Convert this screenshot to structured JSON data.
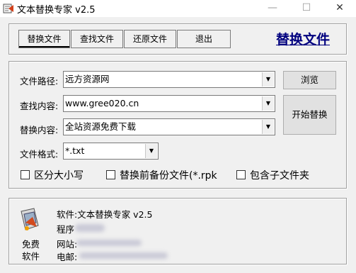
{
  "window": {
    "title": "文本替换专家    v2.5",
    "min_glyph": "—",
    "max_glyph": "☐",
    "close_glyph": "✕"
  },
  "toolbar": {
    "tabs": [
      "替换文件",
      "查找文件",
      "还原文件",
      "退出"
    ],
    "active_tab": "替换文件"
  },
  "page_title": "替换文件",
  "form": {
    "path_label": "文件路径:",
    "path_value": "远方资源网",
    "find_label": "查找内容:",
    "find_value": "www.gree020.cn",
    "replace_label": "替换内容:",
    "replace_value": "全站资源免费下载",
    "format_label": "文件格式:",
    "format_value": "*.txt",
    "browse_button": "浏览",
    "start_button": "开始替换",
    "dropdown_glyph": "▼"
  },
  "options": [
    {
      "label": "区分大小写",
      "checked": false
    },
    {
      "label": "替换前备份文件(*.rpk",
      "checked": false
    },
    {
      "label": "包含子文件夹",
      "checked": false
    }
  ],
  "about": {
    "badge_line1": "免费",
    "badge_line2": "软件",
    "software": "软件:文本替换专家 v2.5",
    "author_label": "程序",
    "site_label": "网站:",
    "email_label": "电邮:"
  }
}
